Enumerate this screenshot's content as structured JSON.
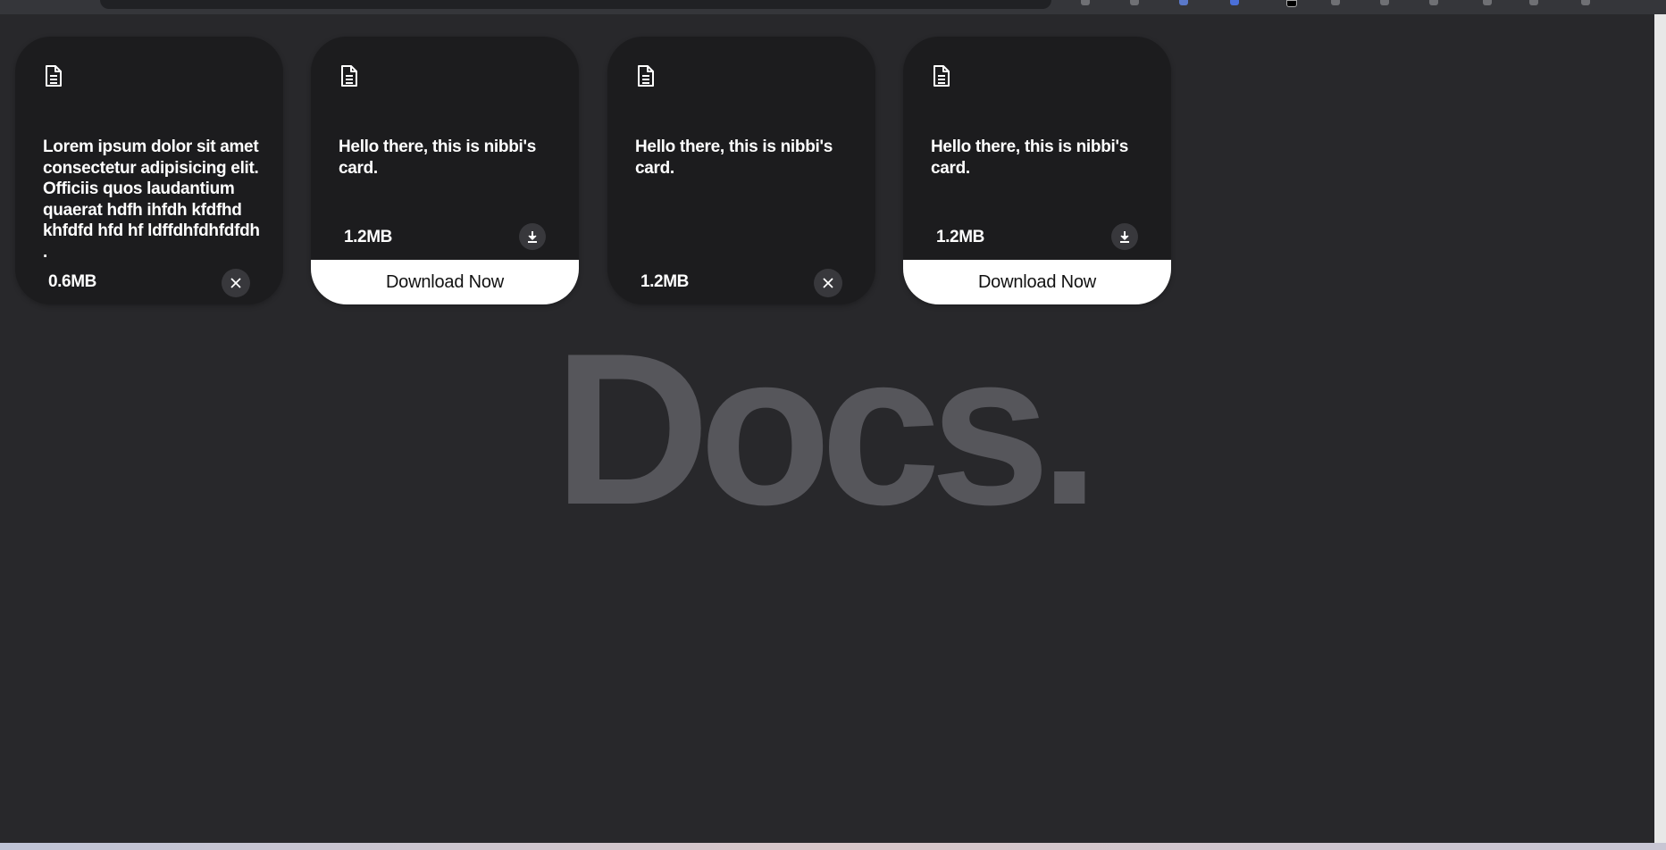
{
  "page": {
    "background_title": "Docs.",
    "background_subtitle": "s."
  },
  "colors": {
    "page_background": "#28282b",
    "card_background": "#1c1c1e",
    "title_color": "#56565b",
    "download_tag_background": "#ffffff"
  },
  "cards": [
    {
      "icon": "document-icon",
      "description": "Lorem ipsum dolor sit amet consectetur adipisicing elit. Officiis quos laudantium quaerat hdfh ihfdh kfdfhd khfdfd hfd hf ldffdhfdhfdfdh .",
      "size": "0.6MB",
      "action_icon": "close-icon",
      "download_tag": ""
    },
    {
      "icon": "document-icon",
      "description": "Hello there, this is nibbi's card.",
      "size": "1.2MB",
      "action_icon": "download-icon",
      "download_tag": "Download Now"
    },
    {
      "icon": "document-icon",
      "description": "Hello there, this is nibbi's card.",
      "size": "1.2MB",
      "action_icon": "close-icon",
      "download_tag": ""
    },
    {
      "icon": "document-icon",
      "description": "Hello there, this is nibbi's card.",
      "size": "1.2MB",
      "action_icon": "download-icon",
      "download_tag": "Download Now"
    }
  ]
}
